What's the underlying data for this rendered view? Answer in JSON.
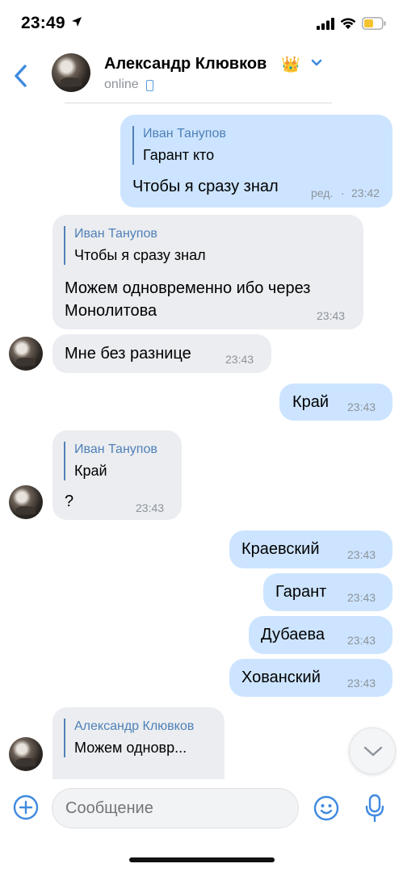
{
  "status_bar": {
    "time": "23:49"
  },
  "header": {
    "contact_name": "Александр Клювков",
    "crown": "👑",
    "status": "online"
  },
  "messages": [
    {
      "dir": "out",
      "reply_to": {
        "author": "Иван Танупов",
        "text": "Гарант кто"
      },
      "text": "Чтобы я сразу знал",
      "edited": "ред.",
      "time": "23:42"
    },
    {
      "dir": "in",
      "reply_to": {
        "author": "Иван Танупов",
        "text": "Чтобы я сразу знал"
      },
      "text_lines": [
        "Можем одновременно ибо через",
        "Монолитова"
      ],
      "time": "23:43"
    },
    {
      "dir": "in",
      "text": "Мне без разнице",
      "time": "23:43"
    },
    {
      "dir": "out",
      "text": "Край",
      "time": "23:43"
    },
    {
      "dir": "in",
      "reply_to": {
        "author": "Иван Танупов",
        "text": "Край"
      },
      "text": "?",
      "time": "23:43"
    },
    {
      "dir": "out",
      "text": "Краевский",
      "time": "23:43"
    },
    {
      "dir": "out",
      "text": "Гарант",
      "time": "23:43"
    },
    {
      "dir": "out",
      "text": "Дубаева",
      "time": "23:43"
    },
    {
      "dir": "out",
      "text": "Хованский",
      "time": "23:43"
    },
    {
      "dir": "in",
      "reply_to": {
        "author": "Александр Клювков",
        "text": "Можем одновр..."
      }
    }
  ],
  "composer": {
    "placeholder": "Сообщение"
  },
  "colors": {
    "accent": "#3f8ae0",
    "outgoing_bubble": "#cce4ff",
    "incoming_bubble": "#ebedf0",
    "reply_name": "#4f80b8"
  }
}
